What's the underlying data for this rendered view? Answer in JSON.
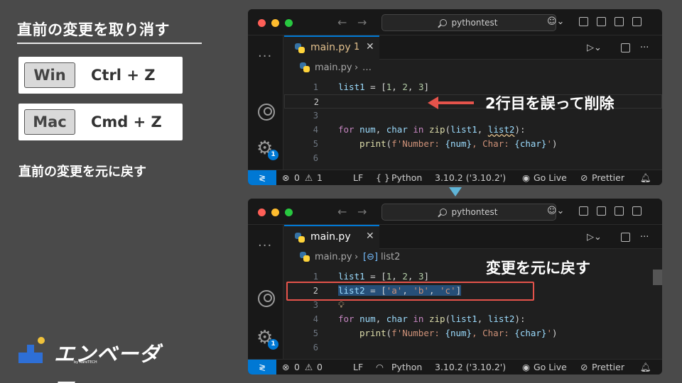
{
  "left": {
    "title": "直前の変更を取り消す",
    "shortcuts": [
      {
        "os": "Win",
        "combo": "Ctrl + Z"
      },
      {
        "os": "Mac",
        "combo": "Cmd + Z"
      }
    ],
    "redo_note": "直前の変更を元に戻す"
  },
  "logo": {
    "text": "エンベーダー",
    "sub": "by RareTECH"
  },
  "annotations": {
    "top": "2行目を誤って削除",
    "bottom": "変更を元に戻す"
  },
  "window_top": {
    "search": "pythontest",
    "tab_label": "main.py",
    "tab_problems": "1",
    "breadcrumb": [
      "main.py",
      "…"
    ],
    "lines": [
      "1",
      "2",
      "3",
      "4",
      "5",
      "6"
    ],
    "status": {
      "errors": "0",
      "warnings": "1",
      "eol": "LF",
      "language": "Python",
      "version": "3.10.2 ('3.10.2')",
      "live": "Go Live",
      "formatter": "Prettier"
    },
    "badge": "1"
  },
  "window_bottom": {
    "search": "pythontest",
    "tab_label": "main.py",
    "breadcrumb": [
      "main.py",
      "list2"
    ],
    "lines": [
      "1",
      "2",
      "3",
      "4",
      "5",
      "6"
    ],
    "status": {
      "errors": "0",
      "warnings": "0",
      "eol": "LF",
      "language": "Python",
      "version": "3.10.2 ('3.10.2')",
      "live": "Go Live",
      "formatter": "Prettier"
    },
    "badge": "1"
  },
  "code": {
    "line1": [
      "list1",
      " = ",
      "[",
      "1",
      ", ",
      "2",
      ", ",
      "3",
      "]"
    ],
    "line2_restored": [
      "list2",
      " = ",
      "[",
      "'a'",
      ", ",
      "'b'",
      ", ",
      "'c'",
      "]"
    ],
    "line4": [
      "for",
      " ",
      "num",
      ", ",
      "char",
      " ",
      "in",
      " ",
      "zip",
      "(",
      "list1",
      ", ",
      "list2",
      "):"
    ],
    "line5": [
      "print",
      "(",
      "f'Number: ",
      "{num}",
      ", Char: ",
      "{char}",
      "'",
      ")"
    ]
  },
  "colors": {
    "accent_blue": "#0078d4",
    "annotation_red": "#e5534b",
    "indicator_cyan": "#5fb5d8"
  }
}
